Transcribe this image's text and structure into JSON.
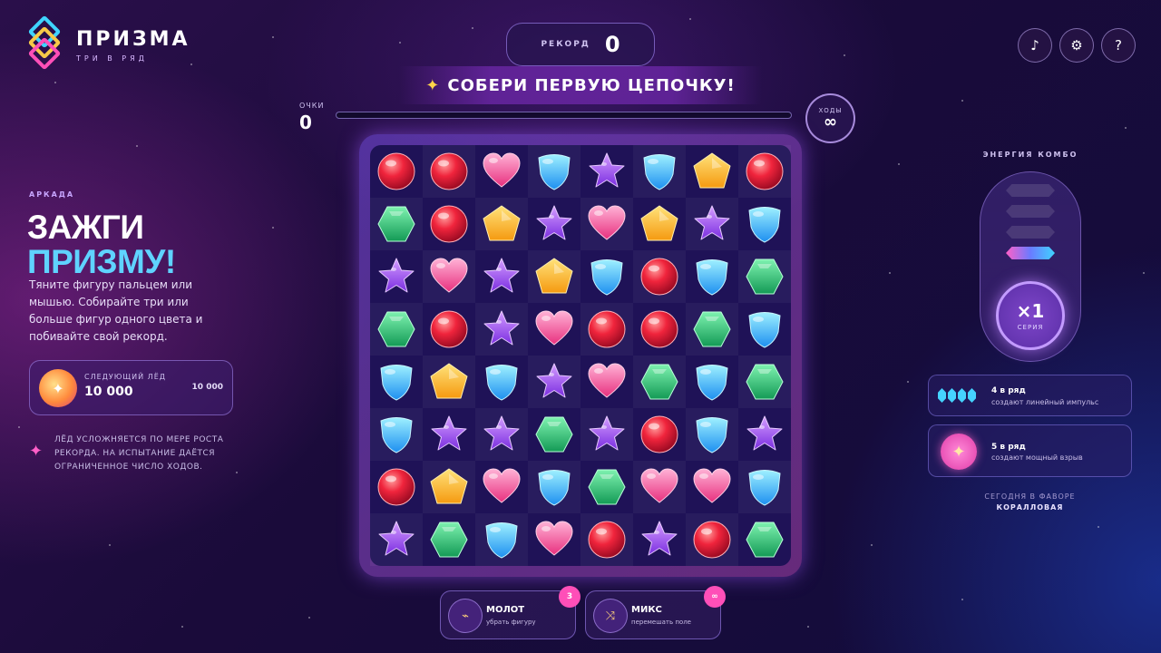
{
  "colors": {
    "accent_cyan": "#5fd3ff",
    "accent_pink": "#ff4fb8",
    "accent_gold": "#ffd54a",
    "board": "#1f1257"
  },
  "logo": {
    "title": "ПРИЗМА",
    "subtitle": "ТРИ В РЯД",
    "icon": "prism-logo-icon"
  },
  "record": {
    "label": "РЕКОРД",
    "value": "0"
  },
  "top_buttons": [
    {
      "name": "music-icon",
      "glyph": "♪"
    },
    {
      "name": "gear-icon",
      "glyph": "⚙"
    },
    {
      "name": "help-icon",
      "glyph": "?"
    }
  ],
  "banner": {
    "text": "СОБЕРИ ПЕРВУЮ ЦЕПОЧКУ!",
    "icon": "sparkle-icon"
  },
  "score": {
    "label": "ОЧКИ",
    "value": "0",
    "progress_percent": 0
  },
  "moves": {
    "label": "ХОДЫ",
    "value": "∞"
  },
  "board": {
    "rows": [
      [
        "red",
        "red",
        "pink",
        "blue",
        "purple",
        "blue",
        "yellow",
        "red"
      ],
      [
        "green",
        "red",
        "yellow",
        "purple",
        "pink",
        "yellow",
        "purple",
        "blue"
      ],
      [
        "purple",
        "pink",
        "purple",
        "yellow",
        "blue",
        "red",
        "blue",
        "green"
      ],
      [
        "green",
        "red",
        "purple",
        "pink",
        "red",
        "red",
        "green",
        "blue"
      ],
      [
        "blue",
        "yellow",
        "blue",
        "purple",
        "pink",
        "green",
        "blue",
        "green"
      ],
      [
        "blue",
        "purple",
        "purple",
        "green",
        "purple",
        "red",
        "blue",
        "purple"
      ],
      [
        "red",
        "yellow",
        "pink",
        "blue",
        "green",
        "pink",
        "pink",
        "blue"
      ],
      [
        "purple",
        "green",
        "blue",
        "pink",
        "red",
        "purple",
        "red",
        "green"
      ]
    ]
  },
  "left": {
    "mode_label": "АРКАДА",
    "headline_line1": "ЗАЖГИ",
    "headline_line2": "ПРИЗМУ!",
    "description": "Тяните фигуру пальцем или мышью. Собирайте три или больше фигур одного цвета и побивайте свой рекорд.",
    "next_ice": {
      "label": "СЛЕДУЮЩИЙ ЛЁД",
      "value": "10 000",
      "right_value": "10 000"
    },
    "hint": "ЛЁД УСЛОЖНЯЕТСЯ ПО МЕРЕ РОСТА РЕКОРДА. НА ИСПЫТАНИЕ ДАЁТСЯ ОГРАНИЧЕННОЕ ЧИСЛО ХОДОВ."
  },
  "right": {
    "combo_label": "ЭНЕРГИЯ КОМБО",
    "combo_level": 1,
    "combo_max": 4,
    "multiplier": "×1",
    "multiplier_label": "СЕРИЯ",
    "tips": [
      {
        "title": "4 в ряд",
        "subtitle": "создают линейный импульс"
      },
      {
        "title": "5 в ряд",
        "subtitle": "создают мощный взрыв"
      }
    ],
    "favor_label": "СЕГОДНЯ В ФАВОРЕ",
    "favor_value": "КОРАЛЛОВАЯ"
  },
  "boosters": [
    {
      "name": "hammer",
      "title": "МОЛОТ",
      "subtitle": "убрать фигуру",
      "badge": "3",
      "icon": "hammer-icon"
    },
    {
      "name": "shuffle",
      "title": "МИКС",
      "subtitle": "перемешать поле",
      "badge": "∞",
      "icon": "shuffle-icon"
    }
  ]
}
